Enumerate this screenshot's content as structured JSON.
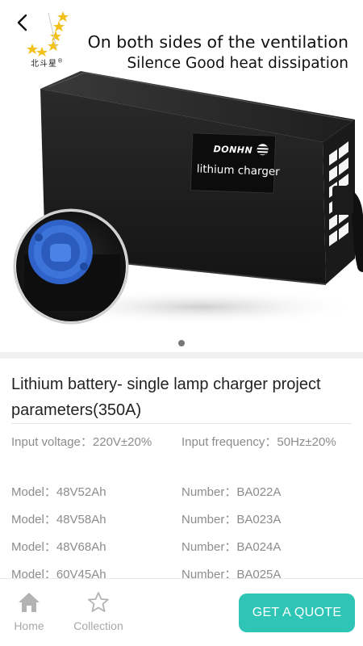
{
  "hero": {
    "logo_text": "北斗星",
    "headline_line1": "On both sides of the ventilation",
    "headline_line2": "Silence Good heat dissipation",
    "brand": "DONHN",
    "product_label": "lithium charger",
    "carousel": {
      "count": 1,
      "active": 1
    }
  },
  "product": {
    "title": "Lithium battery- single lamp charger project parameters(350A)",
    "params": [
      {
        "left": "Input voltage：220V±20%",
        "right": "Input frequency：50Hz±20%"
      },
      {
        "left": "Model：48V52Ah",
        "right": "Number：BA022A"
      },
      {
        "left": "Model：48V58Ah",
        "right": "Number：BA023A"
      },
      {
        "left": "Model：48V68Ah",
        "right": "Number：BA024A"
      },
      {
        "left": "Model：60V45Ah",
        "right": "Number：BA025A"
      }
    ]
  },
  "bottom_nav": {
    "home_label": "Home",
    "collection_label": "Collection",
    "quote_label": "GET A QUOTE"
  },
  "colors": {
    "accent": "#2ec4b6",
    "muted_text": "#8c8c8c",
    "logo_star": "#f2c11a"
  },
  "icons": {
    "back": "chevron-left-icon",
    "home": "home-icon",
    "collection": "star-outline-icon"
  }
}
